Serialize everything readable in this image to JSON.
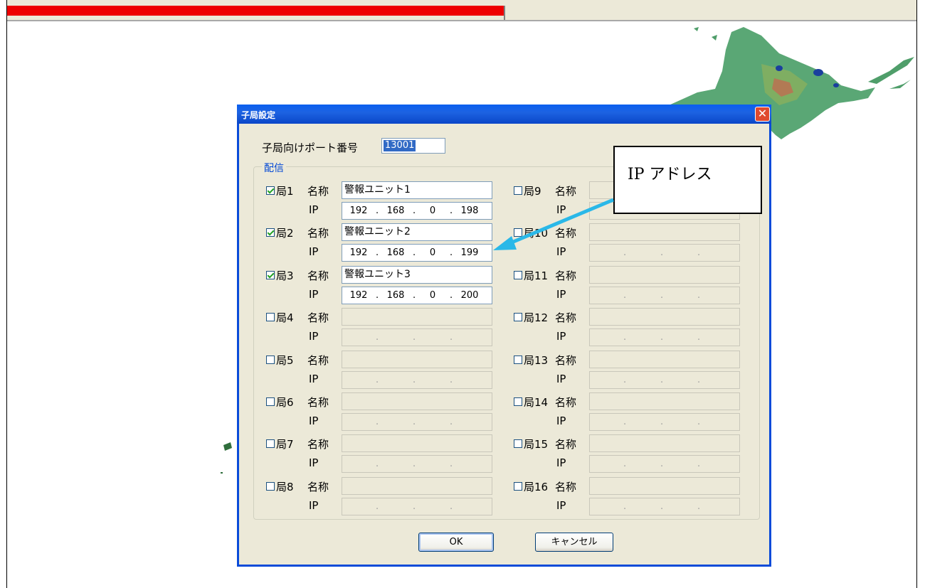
{
  "progress": {
    "fraction": 0.546,
    "fill_color": "#ee0000"
  },
  "dialog": {
    "title": "子局設定",
    "close_glyph": "✕",
    "port_label": "子局向けポート番号",
    "port_value": "13001",
    "group_title": "配信",
    "stations": [
      {
        "label": "局1",
        "name_label": "名称",
        "checked": true,
        "name": "警報ユニット1",
        "ip_label": "IP",
        "ip": [
          "192",
          "168",
          "0",
          "198"
        ]
      },
      {
        "label": "局2",
        "name_label": "名称",
        "checked": true,
        "name": "警報ユニット2",
        "ip_label": "IP",
        "ip": [
          "192",
          "168",
          "0",
          "199"
        ]
      },
      {
        "label": "局3",
        "name_label": "名称",
        "checked": true,
        "name": "警報ユニット3",
        "ip_label": "IP",
        "ip": [
          "192",
          "168",
          "0",
          "200"
        ]
      },
      {
        "label": "局4",
        "name_label": "名称",
        "checked": false,
        "name": "",
        "ip_label": "IP",
        "ip": [
          "",
          "",
          "",
          ""
        ]
      },
      {
        "label": "局5",
        "name_label": "名称",
        "checked": false,
        "name": "",
        "ip_label": "IP",
        "ip": [
          "",
          "",
          "",
          ""
        ]
      },
      {
        "label": "局6",
        "name_label": "名称",
        "checked": false,
        "name": "",
        "ip_label": "IP",
        "ip": [
          "",
          "",
          "",
          ""
        ]
      },
      {
        "label": "局7",
        "name_label": "名称",
        "checked": false,
        "name": "",
        "ip_label": "IP",
        "ip": [
          "",
          "",
          "",
          ""
        ]
      },
      {
        "label": "局8",
        "name_label": "名称",
        "checked": false,
        "name": "",
        "ip_label": "IP",
        "ip": [
          "",
          "",
          "",
          ""
        ]
      },
      {
        "label": "局9",
        "name_label": "名称",
        "checked": false,
        "name": "",
        "ip_label": "IP",
        "ip": [
          "",
          "",
          "",
          ""
        ]
      },
      {
        "label": "局10",
        "name_label": "名称",
        "checked": false,
        "name": "",
        "ip_label": "IP",
        "ip": [
          "",
          "",
          "",
          ""
        ]
      },
      {
        "label": "局11",
        "name_label": "名称",
        "checked": false,
        "name": "",
        "ip_label": "IP",
        "ip": [
          "",
          "",
          "",
          ""
        ]
      },
      {
        "label": "局12",
        "name_label": "名称",
        "checked": false,
        "name": "",
        "ip_label": "IP",
        "ip": [
          "",
          "",
          "",
          ""
        ]
      },
      {
        "label": "局13",
        "name_label": "名称",
        "checked": false,
        "name": "",
        "ip_label": "IP",
        "ip": [
          "",
          "",
          "",
          ""
        ]
      },
      {
        "label": "局14",
        "name_label": "名称",
        "checked": false,
        "name": "",
        "ip_label": "IP",
        "ip": [
          "",
          "",
          "",
          ""
        ]
      },
      {
        "label": "局15",
        "name_label": "名称",
        "checked": false,
        "name": "",
        "ip_label": "IP",
        "ip": [
          "",
          "",
          "",
          ""
        ]
      },
      {
        "label": "局16",
        "name_label": "名称",
        "checked": false,
        "name": "",
        "ip_label": "IP",
        "ip": [
          "",
          "",
          "",
          ""
        ]
      }
    ],
    "ok_label": "OK",
    "cancel_label": "キャンセル"
  },
  "annotation": {
    "text": "IP アドレス",
    "arrow_color": "#2ab8e8"
  }
}
